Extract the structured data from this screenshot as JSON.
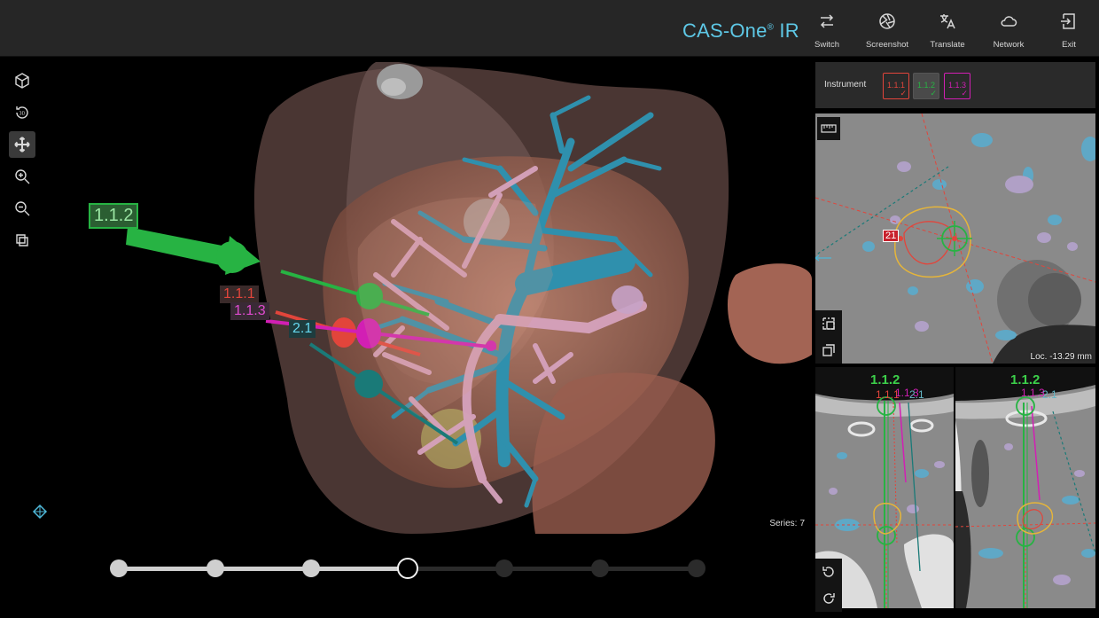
{
  "header": {
    "brand": "CAS-One",
    "brand_mark": "®",
    "brand_suffix": " IR",
    "buttons": [
      {
        "label": "Switch",
        "icon": "switch-icon"
      },
      {
        "label": "Screenshot",
        "icon": "aperture-icon"
      },
      {
        "label": "Translate",
        "icon": "translate-icon"
      },
      {
        "label": "Network",
        "icon": "cloud-icon"
      },
      {
        "label": "Exit",
        "icon": "exit-icon"
      }
    ]
  },
  "viewport3d": {
    "tools": [
      "cube-icon",
      "rotate-3d-icon",
      "move-icon",
      "zoom-in-icon",
      "zoom-out-icon",
      "reset-view-icon"
    ],
    "active_tool": "move-icon",
    "series_label": "Series:",
    "series_value": "7",
    "needle_tags": {
      "t112": "1.1.2",
      "t111": "1.1.1",
      "t113": "1.1.3",
      "t21": "2.1"
    },
    "colors": {
      "green": "#27b343",
      "red": "#e2453b",
      "magenta": "#d21fb4",
      "teal": "#1a7a78",
      "tag_cyan": "#66d7ee",
      "liver": "#c77c66",
      "vessel_blue": "#2f90ad",
      "vessel_pink": "#d6a2bd"
    }
  },
  "timeline": {
    "steps": 7,
    "current_step": 4
  },
  "instrument_bar": {
    "label": "Instrument",
    "instruments": [
      {
        "label": "1.1.1",
        "color": "#e2453b",
        "selected": false
      },
      {
        "label": "1.1.2",
        "color": "#27b343",
        "selected": true
      },
      {
        "label": "1.1.3",
        "color": "#d21fb4",
        "selected": false
      }
    ]
  },
  "axial_view": {
    "target_label": "21",
    "loc_label": "Loc.",
    "loc_value": "-13.29 mm"
  },
  "coronal_view": {
    "title": "1.1.2",
    "needle_labels": [
      "1.1.1",
      "1.1.3",
      "2.1"
    ]
  },
  "sagittal_view": {
    "title": "1.1.2",
    "needle_labels": [
      "1.1.3",
      "2.1"
    ]
  }
}
